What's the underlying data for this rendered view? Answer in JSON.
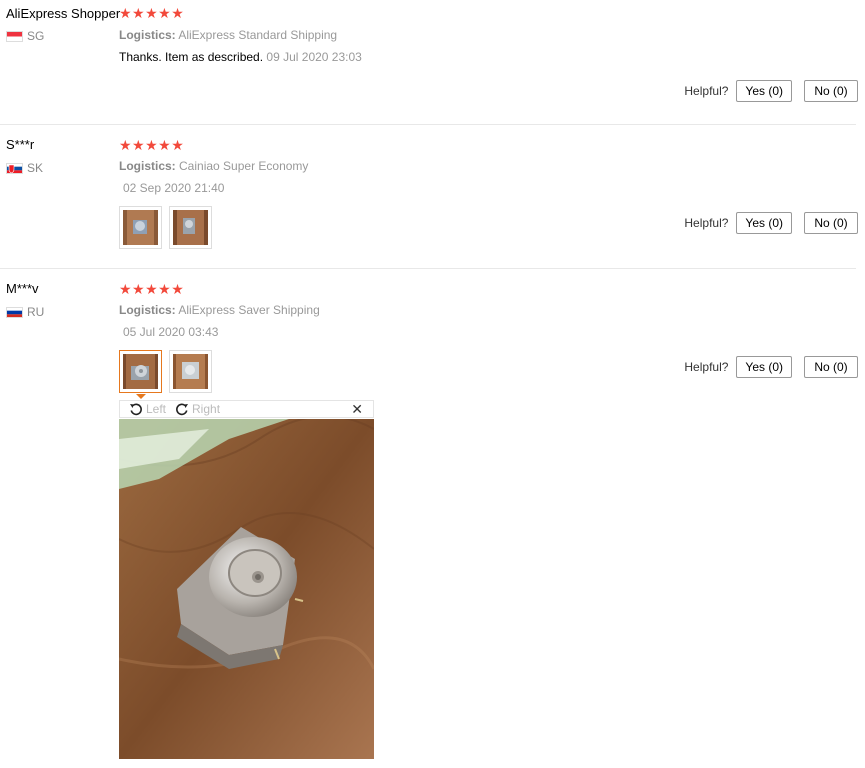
{
  "reviews": [
    {
      "user": "AliExpress Shopper",
      "country": "SG",
      "stars": "★★★★★",
      "logistics_label": "Logistics:",
      "logistics": "AliExpress Standard Shipping",
      "feedback": "Thanks. Item as described.",
      "date": "09 Jul 2020 23:03",
      "helpful_label": "Helpful?",
      "yes_label": "Yes (0)",
      "no_label": "No (0)"
    },
    {
      "user": "S***r",
      "country": "SK",
      "stars": "★★★★★",
      "logistics_label": "Logistics:",
      "logistics": "Cainiao Super Economy",
      "date": "02 Sep 2020 21:40",
      "helpful_label": "Helpful?",
      "yes_label": "Yes (0)",
      "no_label": "No (0)"
    },
    {
      "user": "M***v",
      "country": "RU",
      "stars": "★★★★★",
      "logistics_label": "Logistics:",
      "logistics": "AliExpress Saver Shipping",
      "date": "05 Jul 2020 03:43",
      "helpful_label": "Helpful?",
      "yes_label": "Yes (0)",
      "no_label": "No (0)"
    }
  ],
  "viewer": {
    "rotate_left_label": "Left",
    "rotate_right_label": "Right",
    "close_glyph": "✕"
  },
  "colors": {
    "star": "#f2493b",
    "active_thumb": "#e6781e"
  }
}
